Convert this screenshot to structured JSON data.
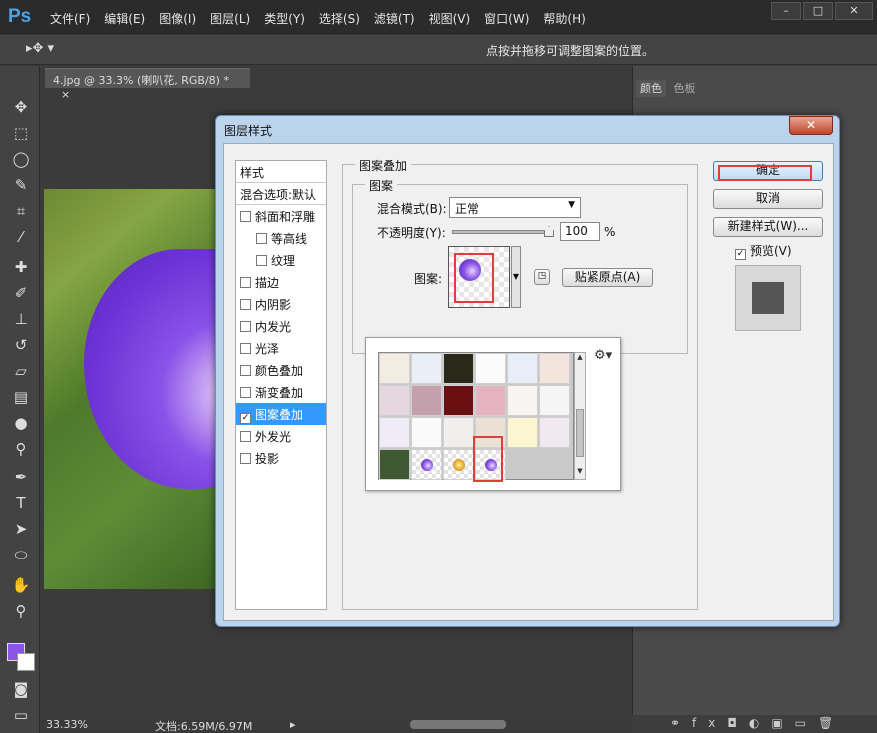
{
  "app": {
    "logo": "Ps",
    "menus": [
      "文件(F)",
      "编辑(E)",
      "图像(I)",
      "图层(L)",
      "类型(Y)",
      "选择(S)",
      "滤镜(T)",
      "视图(V)",
      "窗口(W)",
      "帮助(H)"
    ]
  },
  "optionsbar": {
    "hint": "点按并拖移可调整图案的位置。"
  },
  "document": {
    "tab_title": "4.jpg @ 33.3% (喇叭花, RGB/8) *",
    "tab_close": "×",
    "zoom": "33.33%",
    "doc_info": "文档:6.59M/6.97M"
  },
  "right_panel": {
    "tabs": [
      "颜色",
      "色板"
    ]
  },
  "colors": {
    "foreground": "#8a54e6",
    "background": "#ffffff",
    "highlight": "#e23c3c",
    "selected": "#3399ff"
  },
  "dialog": {
    "title": "图层样式",
    "close": "✕",
    "styles_header": "样式",
    "blend_default": "混合选项:默认",
    "items": [
      {
        "label": "斜面和浮雕",
        "checked": false,
        "indent": false
      },
      {
        "label": "等高线",
        "checked": false,
        "indent": true
      },
      {
        "label": "纹理",
        "checked": false,
        "indent": true
      },
      {
        "label": "描边",
        "checked": false,
        "indent": false
      },
      {
        "label": "内阴影",
        "checked": false,
        "indent": false
      },
      {
        "label": "内发光",
        "checked": false,
        "indent": false
      },
      {
        "label": "光泽",
        "checked": false,
        "indent": false
      },
      {
        "label": "颜色叠加",
        "checked": false,
        "indent": false
      },
      {
        "label": "渐变叠加",
        "checked": false,
        "indent": false
      },
      {
        "label": "图案叠加",
        "checked": true,
        "indent": false,
        "selected": true
      },
      {
        "label": "外发光",
        "checked": false,
        "indent": false
      },
      {
        "label": "投影",
        "checked": false,
        "indent": false
      }
    ],
    "section_title": "图案叠加",
    "group_title": "图案",
    "blend_mode_label": "混合模式(B):",
    "blend_mode_value": "正常",
    "opacity_label": "不透明度(Y):",
    "opacity_value": "100",
    "opacity_unit": "%",
    "pattern_label": "图案:",
    "snap_origin": "贴紧原点(A)",
    "ok": "确定",
    "cancel": "取消",
    "new_style": "新建样式(W)...",
    "preview_label": "预览(V)",
    "preview_checked": true
  },
  "picker": {
    "swatch_colors": [
      [
        "#f3ece3",
        "#e9eff7",
        "#2b2a1a",
        "#fbfbfb",
        "#e8eef7",
        "#f3e5dc"
      ],
      [
        "#e6d6df",
        "#c4a0ac",
        "#6a0f12",
        "#e4b3bf",
        "#f7f4f2",
        "#f5f5f5"
      ],
      [
        "#efecf7",
        "#fafafa",
        "#f2eeee",
        "#eae0d3",
        "#fbf6cf",
        "#f1e9ef"
      ],
      [
        "#3f5a32",
        "#eee",
        "#eee",
        "#eee"
      ]
    ]
  }
}
